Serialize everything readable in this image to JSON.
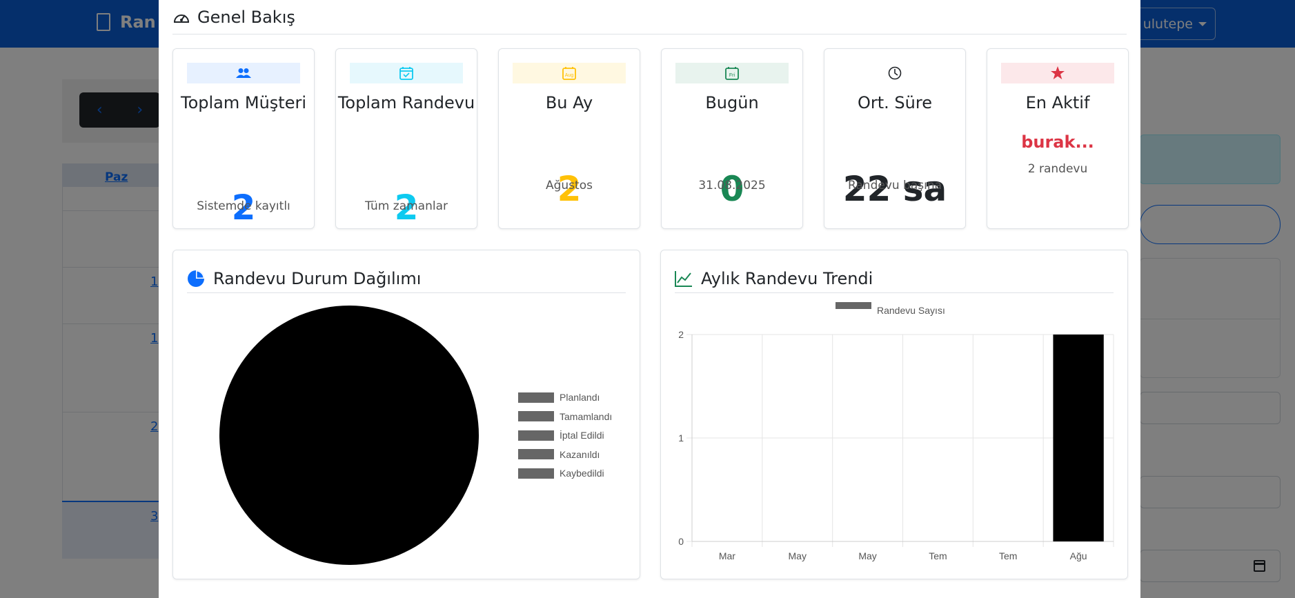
{
  "background": {
    "brand": "Ran",
    "user_menu": "ulutepe",
    "table_header": "Paz",
    "day_numbers": [
      "1",
      "1",
      "2",
      "3"
    ]
  },
  "modal": {
    "title": "Genel Bakış",
    "stats": [
      {
        "label": "Toplam Müşteri",
        "value": "2",
        "sub": "Sistemde kayıtlı",
        "color": "#0d6efd",
        "band": "#e7f1ff",
        "icon": "users-icon"
      },
      {
        "label": "Toplam Randevu",
        "value": "2",
        "sub": "Tüm zamanlar",
        "color": "#0dcaf0",
        "band": "#e6f8fd",
        "icon": "calendar-check-icon"
      },
      {
        "label": "Bu Ay",
        "value": "2",
        "sub": "Ağustos",
        "color": "#ffc107",
        "band": "#fff8e1",
        "icon": "calendar-month-icon",
        "icon_text": "Aug"
      },
      {
        "label": "Bugün",
        "value": "0",
        "sub": "31.08.2025",
        "color": "#198754",
        "band": "#e8f3ee",
        "icon": "calendar-day-icon",
        "icon_text": "Fri"
      },
      {
        "label": "Ort. Süre",
        "value": "22 sa",
        "sub": "Randevu başına",
        "color": "#212529",
        "band": "",
        "icon": "clock-icon"
      },
      {
        "label": "En Aktif",
        "value": "burak...",
        "sub": "2 randevu",
        "color": "#dc3545",
        "band": "#fce8ea",
        "icon": "star-icon"
      }
    ],
    "pie_panel": {
      "title": "Randevu Durum Dağılımı"
    },
    "trend_panel": {
      "title": "Aylık Randevu Trendi"
    }
  },
  "chart_data": [
    {
      "type": "pie",
      "title": "Randevu Durum Dağılımı",
      "categories": [
        "Planlandı",
        "Tamamlandı",
        "İptal Edildi",
        "Kazanıldı",
        "Kaybedildi"
      ],
      "legend_position": "right"
    },
    {
      "type": "bar",
      "title": "Aylık Randevu Trendi",
      "categories": [
        "Mar",
        "May",
        "May",
        "Tem",
        "Tem",
        "Ağu"
      ],
      "series": [
        {
          "name": "Randevu Sayısı",
          "values": [
            0,
            0,
            0,
            0,
            0,
            2
          ]
        }
      ],
      "ylim": [
        0,
        2
      ],
      "yticks": [
        0,
        1,
        2
      ],
      "grid": true,
      "legend_position": "top"
    }
  ]
}
